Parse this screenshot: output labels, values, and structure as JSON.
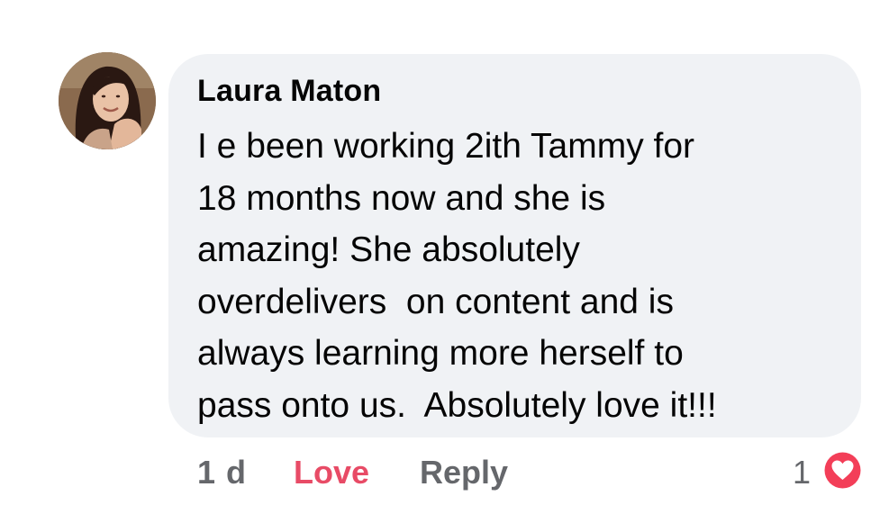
{
  "comment": {
    "author": "Laura Maton",
    "text_lines": [
      "I e been working 2ith Tammy for",
      "18 months now and she is",
      "amazing! She absolutely",
      "overdelivers  on content and is",
      "always learning more herself to",
      "pass onto us.  Absolutely love it!!!"
    ]
  },
  "actions": {
    "time": "1 d",
    "love_label": "Love",
    "reply_label": "Reply",
    "reaction_count": "1",
    "reaction_icon": "heart-icon"
  },
  "colors": {
    "bubble_bg": "#f0f2f5",
    "love": "#e84b66",
    "secondary_text": "#65676b",
    "heart": "#f33e58"
  }
}
